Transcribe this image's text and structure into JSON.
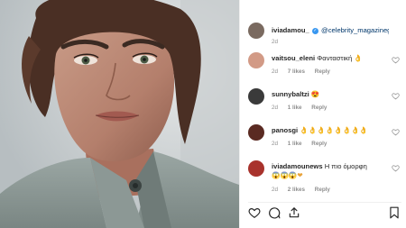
{
  "post": {
    "owner": "iviadamou_",
    "caption_mention": "@celebrity_magazinegr",
    "age": "2d"
  },
  "comments": [
    {
      "user": "vaitsou_eleni",
      "text": "Φανταστική",
      "emoji": "👌",
      "age": "2d",
      "likes": "7 likes",
      "reply": "Reply",
      "avatar_color": "#d29a86"
    },
    {
      "user": "sunnybaltzi",
      "text": "",
      "emoji": "😍",
      "age": "2d",
      "likes": "1 like",
      "reply": "Reply",
      "avatar_color": "#3a3a3a"
    },
    {
      "user": "panosgi",
      "text": "",
      "emoji": "👌👌👌👌👌👌👌👌",
      "age": "2d",
      "likes": "1 like",
      "reply": "Reply",
      "avatar_color": "#5a2a22"
    },
    {
      "user": "iviadamounews",
      "text": "Η πιο όμορφη",
      "emoji": "😱😱😱❤",
      "age": "2d",
      "likes": "2 likes",
      "reply": "Reply",
      "avatar_color": "#a8322c"
    }
  ],
  "icons": {
    "like": "heart-icon",
    "comment": "comment-icon",
    "share": "share-icon",
    "save": "bookmark-icon",
    "verified": "verified-badge-icon"
  },
  "colors": {
    "accent": "#3897f0",
    "text": "#262626",
    "muted": "#8e8e8e",
    "mention": "#00376b"
  }
}
